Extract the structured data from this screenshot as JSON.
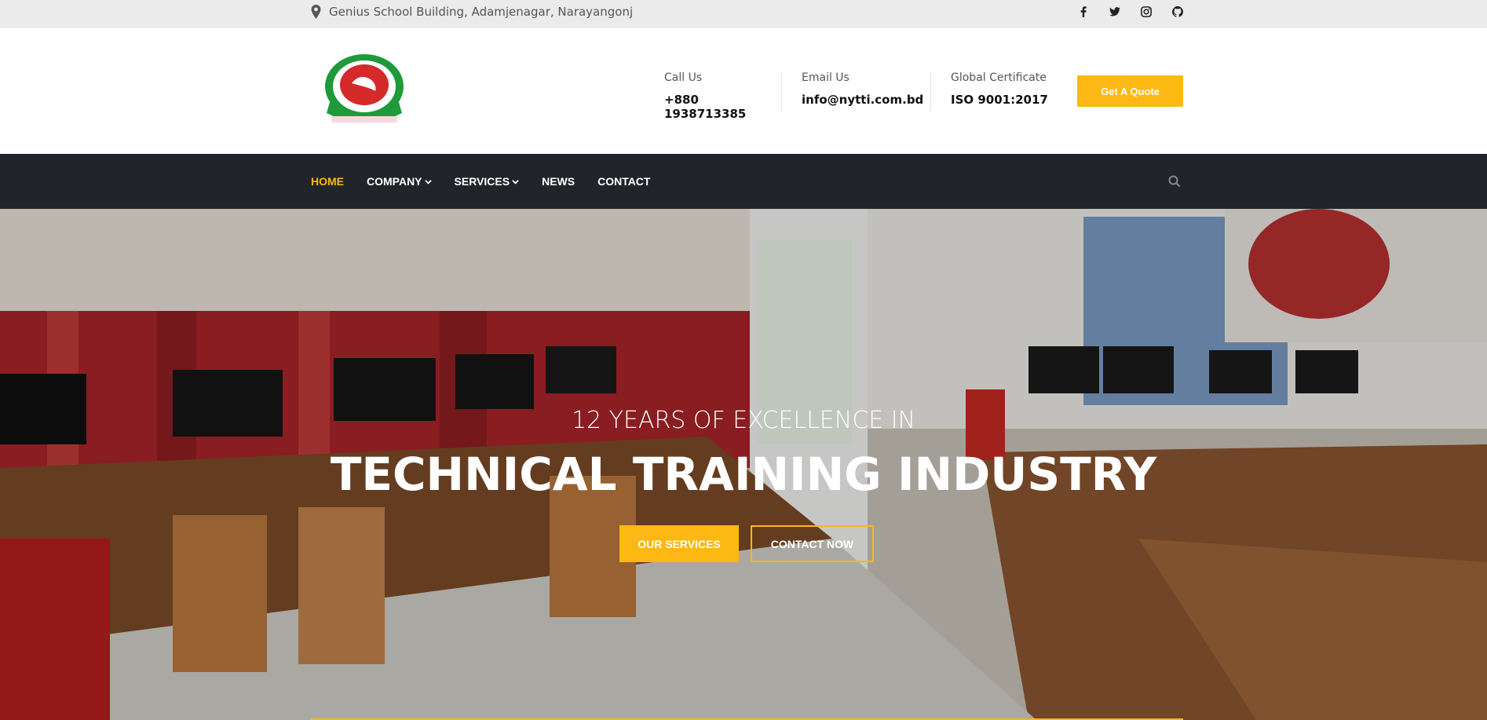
{
  "topbar": {
    "address": "Genius School Building, Adamjenagar, Narayangonj",
    "socials": [
      "facebook-icon",
      "twitter-icon",
      "instagram-icon",
      "github-icon"
    ]
  },
  "header": {
    "call": {
      "label": "Call Us",
      "value": "+880 1938713385"
    },
    "email": {
      "label": "Email Us",
      "value": "info@nytti.com.bd"
    },
    "certificate": {
      "label": "Global Certificate",
      "value": "ISO 9001:2017"
    },
    "quote_button": "Get A Quote"
  },
  "nav": {
    "items": [
      {
        "label": "HOME",
        "active": true,
        "dropdown": false
      },
      {
        "label": "COMPANY",
        "active": false,
        "dropdown": true
      },
      {
        "label": "SERVICES",
        "active": false,
        "dropdown": true
      },
      {
        "label": "NEWS",
        "active": false,
        "dropdown": false
      },
      {
        "label": "CONTACT",
        "active": false,
        "dropdown": false
      }
    ]
  },
  "hero": {
    "subtitle": "12 YEARS OF EXCELLENCE IN",
    "title": "TECHNICAL TRAINING INDUSTRY",
    "primary_button": "OUR SERVICES",
    "secondary_button": "CONTACT NOW"
  },
  "colors": {
    "accent": "#fdb813",
    "nav_bg": "#212529",
    "topbar_bg": "#ebebeb"
  }
}
